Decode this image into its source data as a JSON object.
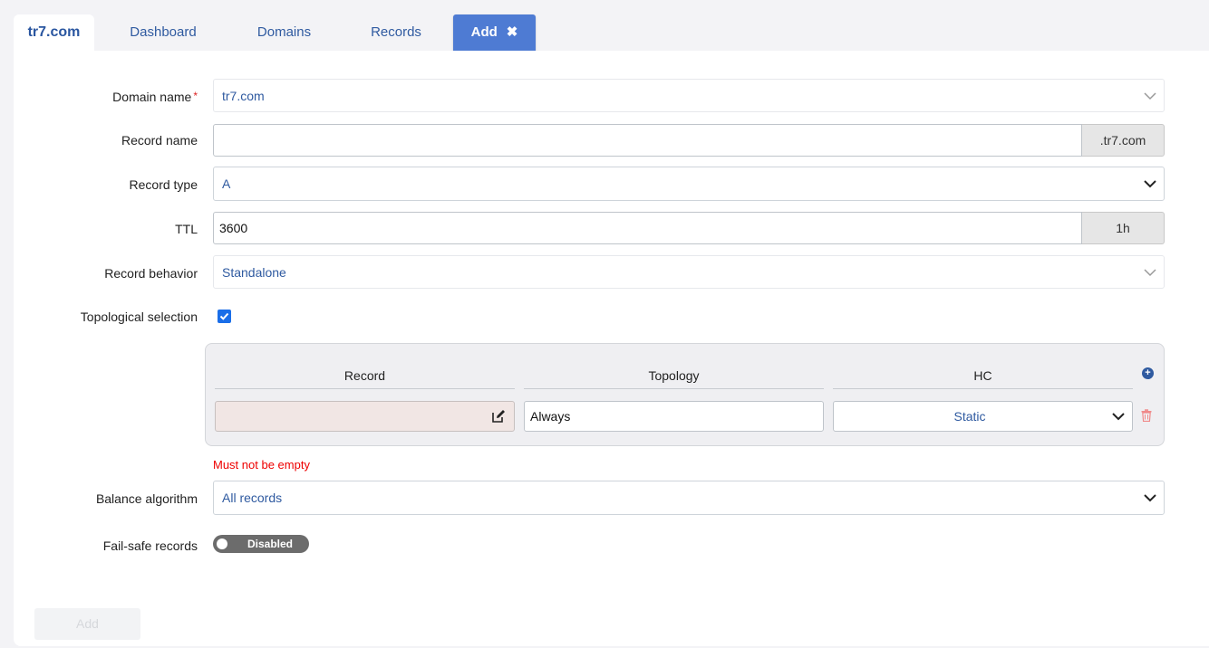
{
  "tabs": {
    "brand": "tr7.com",
    "dashboard": "Dashboard",
    "domains": "Domains",
    "records": "Records",
    "add": "Add",
    "close_icon": "close-icon"
  },
  "form": {
    "domain_name": {
      "label": "Domain name",
      "required_mark": "*",
      "value": "tr7.com"
    },
    "record_name": {
      "label": "Record name",
      "value": "",
      "suffix": ".tr7.com"
    },
    "record_type": {
      "label": "Record type",
      "value": "A"
    },
    "ttl": {
      "label": "TTL",
      "value": "3600",
      "suffix": "1h"
    },
    "record_behavior": {
      "label": "Record behavior",
      "value": "Standalone"
    },
    "topological_selection": {
      "label": "Topological selection",
      "checked": true
    },
    "topology_table": {
      "headers": [
        "Record",
        "Topology",
        "HC"
      ],
      "rows": [
        {
          "record": "",
          "topology": "Always",
          "hc": "Static"
        }
      ]
    },
    "error": "Must not be empty",
    "balance_algorithm": {
      "label": "Balance algorithm",
      "value": "All records"
    },
    "fail_safe": {
      "label": "Fail-safe records",
      "toggle_text": "Disabled"
    },
    "submit_label": "Add"
  },
  "colors": {
    "accent": "#4e7bd3",
    "link": "#2f5aa0",
    "error": "#e00000",
    "checkbox": "#1a6ee8"
  }
}
